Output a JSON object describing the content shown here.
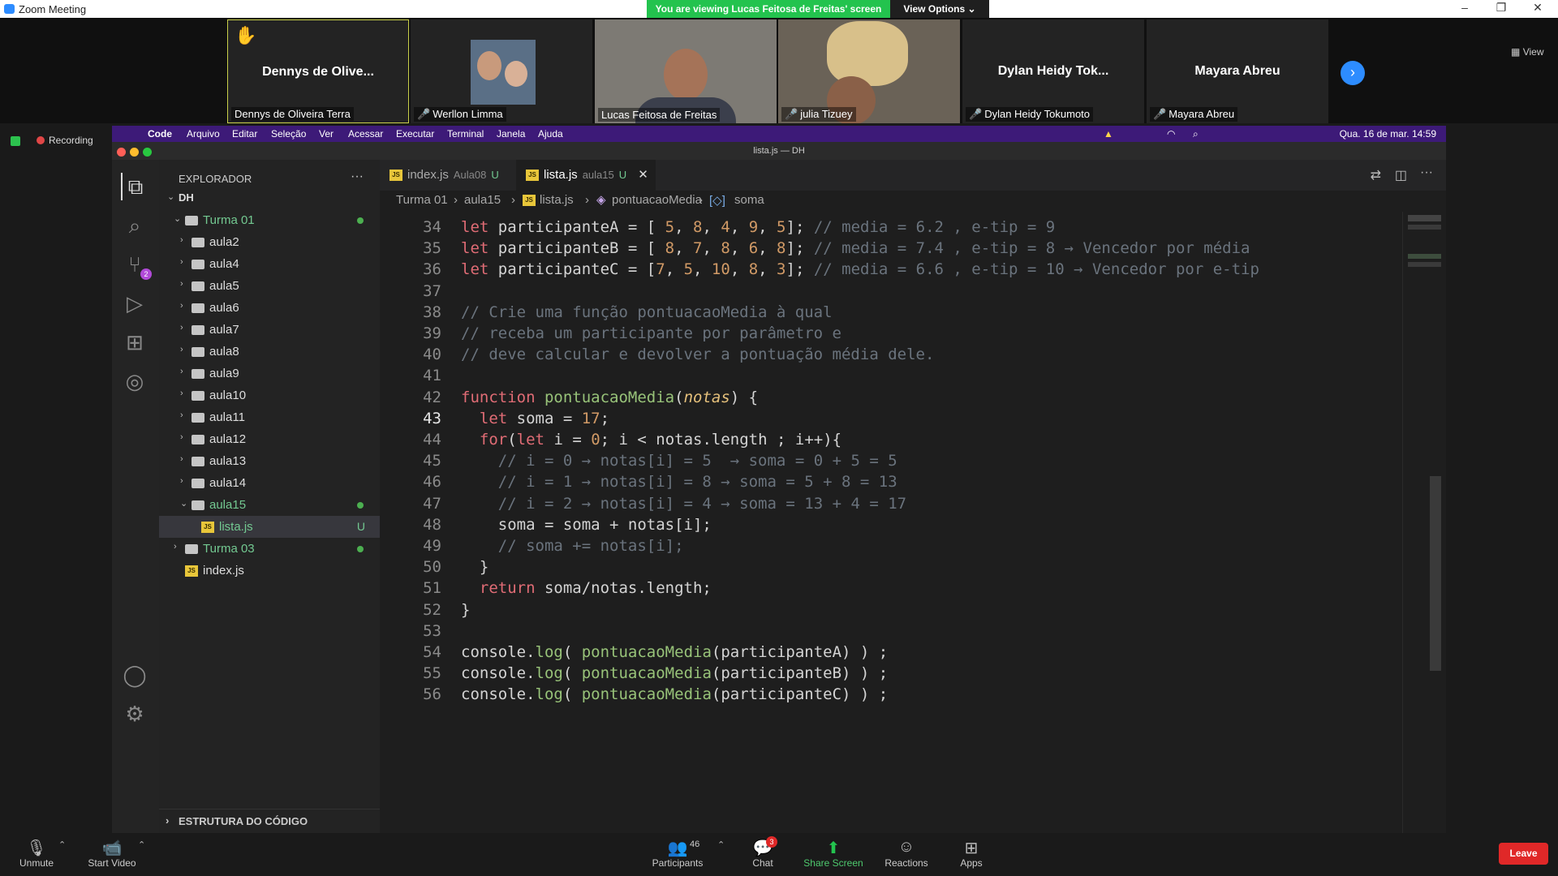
{
  "window": {
    "title": "Zoom Meeting"
  },
  "banner": {
    "text": "You are viewing Lucas Feitosa de Freitas' screen",
    "view_options": "View Options"
  },
  "window_controls": {
    "min": "–",
    "max": "❐",
    "close": "✕"
  },
  "participants": [
    {
      "name_display": "Dennys de Olive...",
      "label": "Dennys de Oliveira Terra",
      "hand_raised": true
    },
    {
      "name_display": "",
      "label": "Werllon Limma",
      "muted": true
    },
    {
      "name_display": "",
      "label": "Lucas Feitosa de Freitas",
      "muted": false
    },
    {
      "name_display": "",
      "label": "julia Tizuey",
      "muted": true
    },
    {
      "name_display": "Dylan Heidy Tok...",
      "label": "Dylan Heidy Tokumoto",
      "muted": true
    },
    {
      "name_display": "Mayara Abreu",
      "label": "Mayara Abreu",
      "muted": true
    }
  ],
  "view_label": "View",
  "recording_label": "Recording",
  "mac_menu": [
    "Code",
    "Arquivo",
    "Editar",
    "Seleção",
    "Ver",
    "Acessar",
    "Executar",
    "Terminal",
    "Janela",
    "Ajuda"
  ],
  "mac_clock": "Qua. 16 de mar.  14:59",
  "editor_window_title": "lista.js — DH",
  "explorer": {
    "title": "EXPLORADOR",
    "more": "···",
    "root": "DH",
    "items": [
      {
        "label": "Turma 01",
        "type": "folder-open",
        "depth": 1,
        "dot": true
      },
      {
        "label": "aula2",
        "type": "folder",
        "depth": 2
      },
      {
        "label": "aula4",
        "type": "folder",
        "depth": 2
      },
      {
        "label": "aula5",
        "type": "folder",
        "depth": 2
      },
      {
        "label": "aula6",
        "type": "folder",
        "depth": 2
      },
      {
        "label": "aula7",
        "type": "folder",
        "depth": 2
      },
      {
        "label": "aula8",
        "type": "folder",
        "depth": 2
      },
      {
        "label": "aula9",
        "type": "folder",
        "depth": 2
      },
      {
        "label": "aula10",
        "type": "folder",
        "depth": 2
      },
      {
        "label": "aula11",
        "type": "folder",
        "depth": 2
      },
      {
        "label": "aula12",
        "type": "folder",
        "depth": 2
      },
      {
        "label": "aula13",
        "type": "folder",
        "depth": 2
      },
      {
        "label": "aula14",
        "type": "folder",
        "depth": 2
      },
      {
        "label": "aula15",
        "type": "folder-open",
        "depth": 2,
        "dot": true
      },
      {
        "label": "lista.js",
        "type": "js",
        "depth": 3,
        "badge": "U",
        "selected": true
      },
      {
        "label": "Turma 03",
        "type": "folder",
        "depth": 1,
        "dot": true
      },
      {
        "label": "index.js",
        "type": "js",
        "depth": 1
      }
    ],
    "outline": "ESTRUTURA DO CÓDIGO"
  },
  "tabs": [
    {
      "label": "index.js",
      "sub": "Aula08",
      "badge": "U"
    },
    {
      "label": "lista.js",
      "sub": "aula15",
      "badge": "U",
      "close": "✕"
    }
  ],
  "breadcrumb": [
    "Turma 01",
    "aula15",
    "lista.js",
    "pontuacaoMedia",
    "soma"
  ],
  "code_lines": [
    {
      "n": "34",
      "t": "let participanteA = [ 5, 8, 4, 9, 5]; // media = 6.2 , e-tip = 9"
    },
    {
      "n": "35",
      "t": "let participanteB = [ 8, 7, 8, 6, 8]; // media = 7.4 , e-tip = 8 → Vencedor por média"
    },
    {
      "n": "36",
      "t": "let participanteC = [7, 5, 10, 8, 3]; // media = 6.6 , e-tip = 10 → Vencedor por e-tip"
    },
    {
      "n": "37",
      "t": ""
    },
    {
      "n": "38",
      "t": "// Crie uma função pontuacaoMedia à qual"
    },
    {
      "n": "39",
      "t": "// receba um participante por parâmetro e"
    },
    {
      "n": "40",
      "t": "// deve calcular e devolver a pontuação média dele."
    },
    {
      "n": "41",
      "t": ""
    },
    {
      "n": "42",
      "t": "function pontuacaoMedia(notas) {"
    },
    {
      "n": "43",
      "t": "  let soma = 17;"
    },
    {
      "n": "44",
      "t": "  for(let i = 0; i < notas.length ; i++){"
    },
    {
      "n": "45",
      "t": "    // i = 0 → notas[i] = 5  → soma = 0 + 5 = 5"
    },
    {
      "n": "46",
      "t": "    // i = 1 → notas[i] = 8 → soma = 5 + 8 = 13"
    },
    {
      "n": "47",
      "t": "    // i = 2 → notas[i] = 4 → soma = 13 + 4 = 17"
    },
    {
      "n": "48",
      "t": "    soma = soma + notas[i];"
    },
    {
      "n": "49",
      "t": "    // soma += notas[i];"
    },
    {
      "n": "50",
      "t": "  }"
    },
    {
      "n": "51",
      "t": "  return soma/notas.length;"
    },
    {
      "n": "52",
      "t": "}"
    },
    {
      "n": "53",
      "t": ""
    },
    {
      "n": "54",
      "t": "console.log( pontuacaoMedia(participanteA) ) ;"
    },
    {
      "n": "55",
      "t": "console.log( pontuacaoMedia(participanteB) ) ;"
    },
    {
      "n": "56",
      "t": "console.log( pontuacaoMedia(participanteC) ) ;"
    }
  ],
  "toolbar": {
    "unmute": "Unmute",
    "start_video": "Start Video",
    "participants": "Participants",
    "participants_count": "46",
    "chat": "Chat",
    "chat_badge": "3",
    "share": "Share Screen",
    "reactions": "Reactions",
    "apps": "Apps",
    "leave": "Leave"
  },
  "scm_badge": "2",
  "colors": {
    "zoom_blue": "#2d8cff",
    "share_green": "#23c34e",
    "leave_red": "#e02828",
    "mac_menubar": "#3d1a78"
  }
}
